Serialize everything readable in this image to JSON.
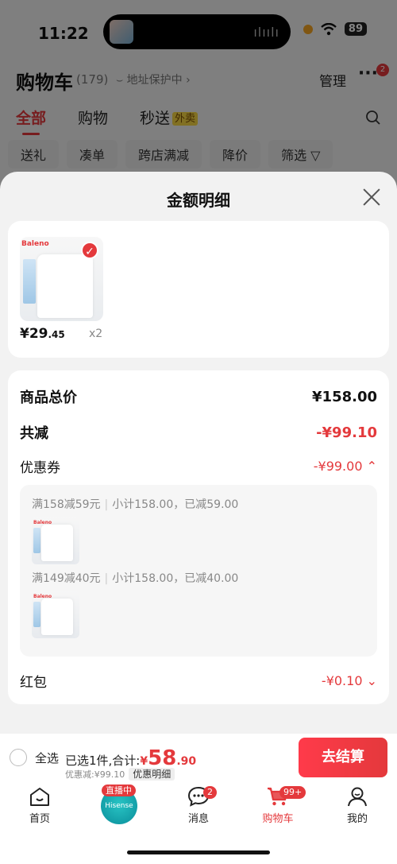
{
  "status": {
    "time": "11:22",
    "battery": "89"
  },
  "header": {
    "title": "购物车",
    "count": "(179)",
    "address": "地址保护中",
    "manage": "管理",
    "more_badge": "2"
  },
  "tabs": [
    {
      "label": "全部"
    },
    {
      "label": "购物"
    },
    {
      "label": "秒送",
      "tag": "外卖"
    }
  ],
  "chips": [
    "送礼",
    "凑单",
    "跨店满减",
    "降价",
    "筛选"
  ],
  "sheet": {
    "title": "金额明细",
    "product": {
      "brand": "Baleno",
      "price_int": "¥29",
      "price_dec": ".45",
      "qty": "x2"
    },
    "summary": {
      "total_label": "商品总价",
      "total_value": "¥158.00",
      "reduce_label": "共减",
      "reduce_value": "-¥99.10",
      "coupon_label": "优惠券",
      "coupon_value": "-¥99.00",
      "coupons": [
        {
          "rule": "满158减59元",
          "detail": "小计158.00，已减59.00"
        },
        {
          "rule": "满149减40元",
          "detail": "小计158.00，已减40.00"
        }
      ],
      "redpack_label": "红包",
      "redpack_value": "-¥0.10"
    }
  },
  "checkout": {
    "select_all": "全选",
    "selected": "已选1件,合计:",
    "yen": "¥",
    "total_int": "58",
    "total_dec": ".90",
    "discount": "优惠减:¥99.10",
    "detail_chip": "优惠明细",
    "button": "去结算"
  },
  "nav": {
    "home": "首页",
    "live_tag": "直播中",
    "live_brand": "Hisense",
    "messages": "消息",
    "messages_badge": "2",
    "cart": "购物车",
    "cart_badge": "99+",
    "me": "我的"
  },
  "colors": {
    "accent": "#e4393c"
  }
}
